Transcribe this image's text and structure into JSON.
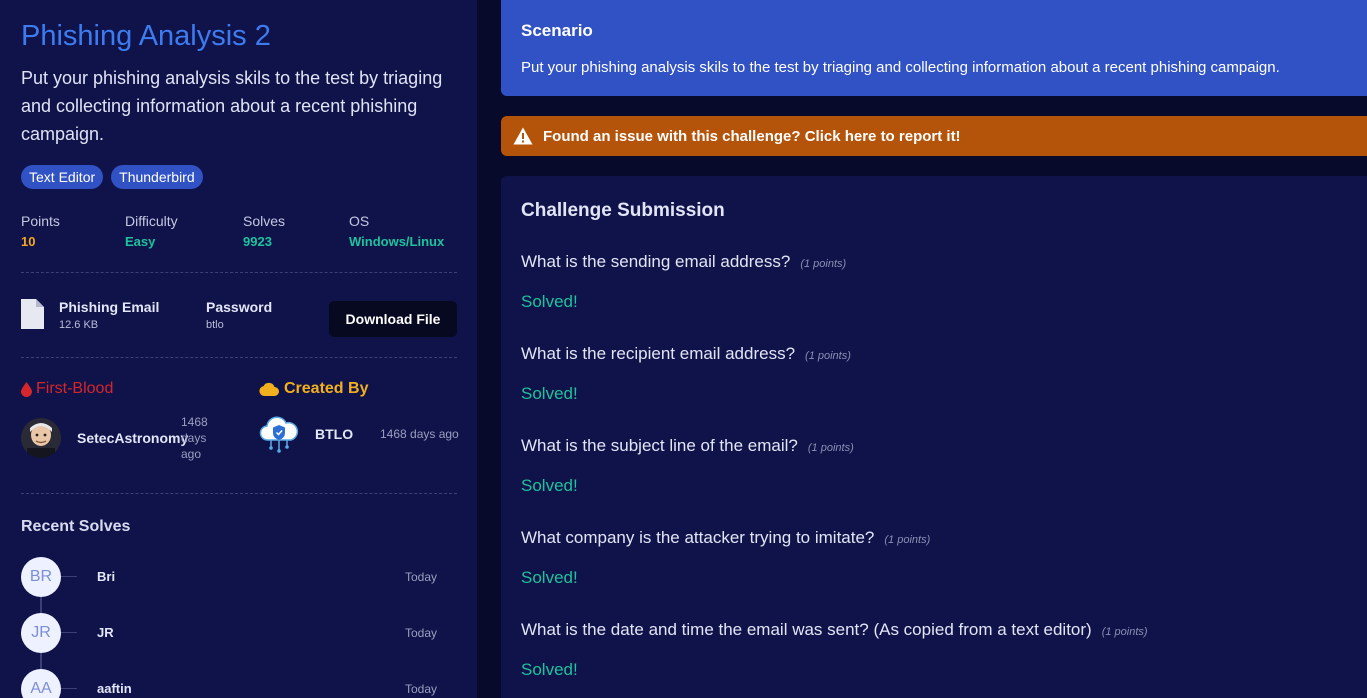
{
  "challenge": {
    "title": "Phishing Analysis 2",
    "description": "Put your phishing analysis skils to the test by triaging and collecting information about a recent phishing campaign.",
    "tags": [
      "Text Editor",
      "Thunderbird"
    ],
    "stats": {
      "points_label": "Points",
      "points_value": "10",
      "difficulty_label": "Difficulty",
      "difficulty_value": "Easy",
      "solves_label": "Solves",
      "solves_value": "9923",
      "os_label": "OS",
      "os_value": "Windows/Linux"
    },
    "colors": {
      "points": "#f5a623",
      "green": "#1cc39c",
      "accent": "#3d7bf0",
      "firstblood": "#d6252b",
      "created": "#f2b01e"
    }
  },
  "file": {
    "name": "Phishing Email",
    "size": "12.6 KB",
    "password_label": "Password",
    "password_value": "btlo",
    "download_label": "Download File"
  },
  "first_blood": {
    "header": "First-Blood",
    "user": "SetecAstronomy",
    "time": "1468 days ago"
  },
  "created_by": {
    "header": "Created By",
    "user": "BTLO",
    "time": "1468 days ago"
  },
  "recent_solves": {
    "title": "Recent Solves",
    "items": [
      {
        "initials": "BR",
        "name": "Bri",
        "time": "Today"
      },
      {
        "initials": "JR",
        "name": "JR",
        "time": "Today"
      },
      {
        "initials": "AA",
        "name": "aaftin",
        "time": "Today"
      }
    ]
  },
  "scenario": {
    "title": "Scenario",
    "text": "Put your phishing analysis skils to the test by triaging and collecting information about a recent phishing campaign."
  },
  "report": {
    "text": "Found an issue with this challenge? Click here to report it!"
  },
  "submission": {
    "title": "Challenge Submission",
    "questions": [
      {
        "text": "What is the sending email address?",
        "points": "(1 points)",
        "status": "Solved!"
      },
      {
        "text": "What is the recipient email address?",
        "points": "(1 points)",
        "status": "Solved!"
      },
      {
        "text": "What is the subject line of the email?",
        "points": "(1 points)",
        "status": "Solved!"
      },
      {
        "text": "What company is the attacker trying to imitate?",
        "points": "(1 points)",
        "status": "Solved!"
      },
      {
        "text": "What is the date and time the email was sent? (As copied from a text editor)",
        "points": "(1 points)",
        "status": "Solved!"
      }
    ]
  }
}
